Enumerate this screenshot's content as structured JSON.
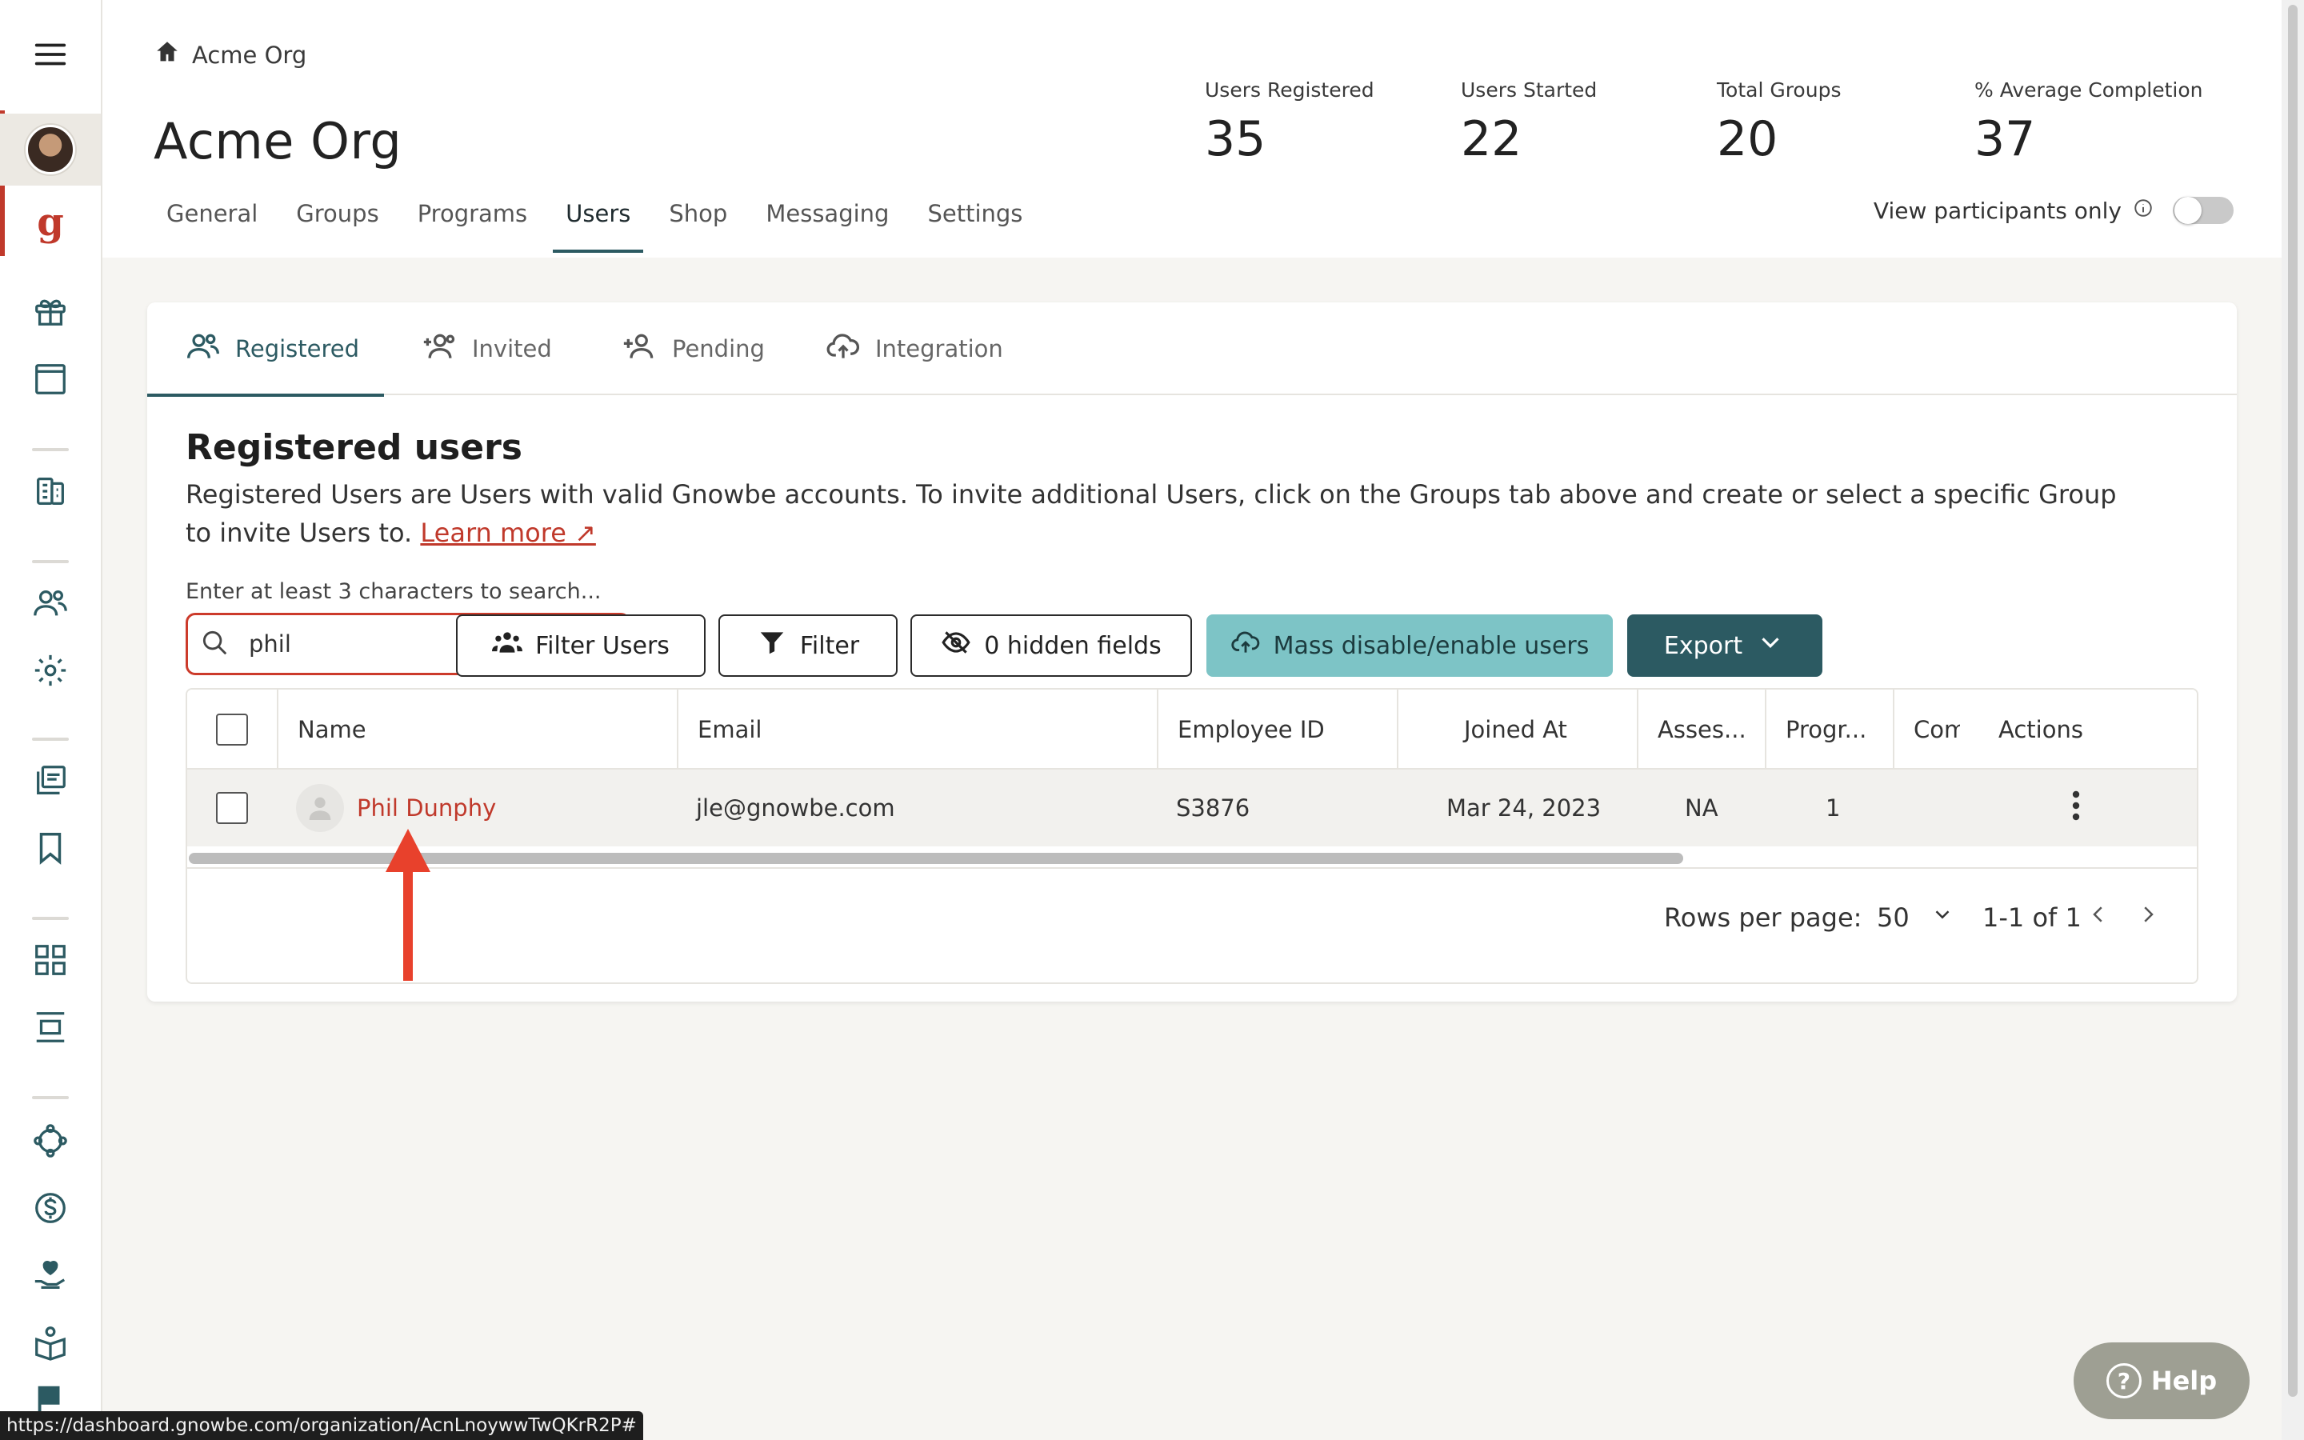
{
  "breadcrumb": {
    "label": "Acme Org"
  },
  "header": {
    "title": "Acme Org",
    "stats": [
      {
        "label": "Users Registered",
        "value": "35"
      },
      {
        "label": "Users Started",
        "value": "22"
      },
      {
        "label": "Total Groups",
        "value": "20"
      },
      {
        "label": "% Average Completion",
        "value": "37"
      }
    ],
    "tabs": [
      "General",
      "Groups",
      "Programs",
      "Users",
      "Shop",
      "Messaging",
      "Settings"
    ],
    "active_tab": "Users",
    "participants_label": "View participants only",
    "participants_toggle": "off"
  },
  "brand": {
    "letter": "g"
  },
  "subtabs": [
    {
      "label": "Registered",
      "icon": "users-icon",
      "active": true
    },
    {
      "label": "Invited",
      "icon": "user-plus-group-icon",
      "active": false
    },
    {
      "label": "Pending",
      "icon": "user-add-icon",
      "active": false
    },
    {
      "label": "Integration",
      "icon": "cloud-upload-icon",
      "active": false
    }
  ],
  "section": {
    "title": "Registered users",
    "description": "Registered Users are Users with valid Gnowbe accounts. To invite additional Users, click on the Groups tab above and create or select a specific Group to invite Users to.",
    "learn_more": "Learn more ↗"
  },
  "search": {
    "hint": "Enter at least 3 characters to search...",
    "value": "phil",
    "placeholder": ""
  },
  "toolbar": {
    "filter_users": "Filter Users",
    "filter": "Filter",
    "hidden_fields": "0 hidden fields",
    "mass_disable": "Mass disable/enable users",
    "export": "Export"
  },
  "table": {
    "columns": [
      "Name",
      "Email",
      "Employee ID",
      "Joined At",
      "Asses...",
      "Progr...",
      "Com",
      "Actions"
    ],
    "rows": [
      {
        "name": "Phil Dunphy",
        "email": "jle@gnowbe.com",
        "employee_id": "S3876",
        "joined_at": "Mar 24, 2023",
        "assessment": "NA",
        "progress": "1",
        "completion": ""
      }
    ]
  },
  "pagination": {
    "rows_label": "Rows per page:",
    "rows_value": "50",
    "range": "1-1 of 1"
  },
  "help": {
    "label": "Help",
    "glyph": "?"
  },
  "statusbar": {
    "url": "https://dashboard.gnowbe.com/organization/AcnLnoywwTwQKrR2P#"
  },
  "colors": {
    "accent": "#2c5a62",
    "brand_red": "#c0392b",
    "teal_button": "#7dc4c6",
    "annotation": "#e8412c"
  }
}
